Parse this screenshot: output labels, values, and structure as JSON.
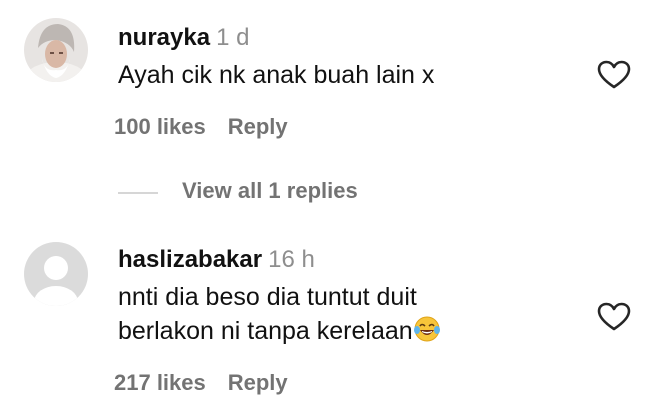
{
  "comments": [
    {
      "username": "nurayka",
      "time": "1 d",
      "text_lines": [
        "Ayah cik nk anak buah lain x"
      ],
      "likes": "100 likes",
      "reply": "Reply",
      "avatar": "profile-photo",
      "like_icon": "heart-outline-icon"
    },
    {
      "username": "haslizabakar",
      "time": "16 h",
      "text_lines": [
        "nnti dia beso dia tuntut duit",
        "berlakon ni tanpa kerelaan"
      ],
      "emoji": "face-with-tears-of-joy-emoji",
      "likes": "217 likes",
      "reply": "Reply",
      "avatar": "default-avatar",
      "like_icon": "heart-outline-icon"
    }
  ],
  "view_replies": "View all 1 replies"
}
